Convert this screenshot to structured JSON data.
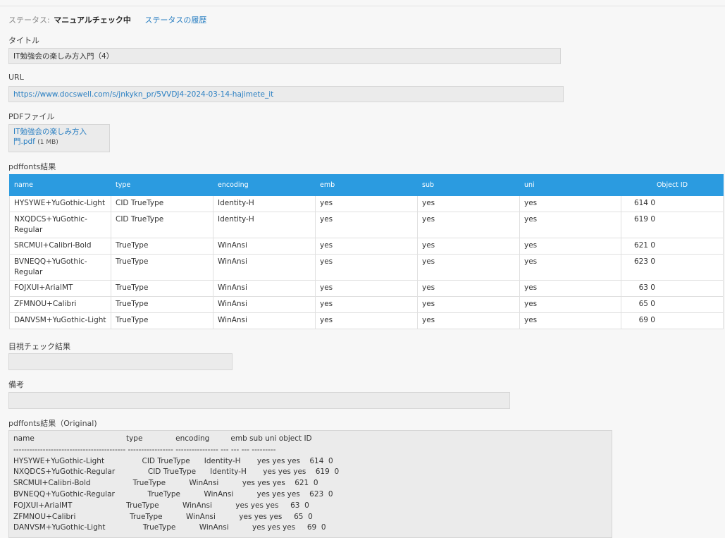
{
  "status": {
    "label": "ステータス:",
    "value": "マニュアルチェック中",
    "history_link": "ステータスの履歴"
  },
  "title": {
    "label": "タイトル",
    "value": "IT勉強会の楽しみ方入門（4）"
  },
  "url": {
    "label": "URL",
    "value": "https://www.docswell.com/s/jnkykn_pr/5VVDJ4-2024-03-14-hajimete_it"
  },
  "pdf": {
    "label": "PDFファイル",
    "link_line1": "IT勉強会の楽しみ方入",
    "link_line2": "門.pdf",
    "size": "(1 MB)"
  },
  "pdffonts": {
    "label": "pdffonts結果",
    "columns": [
      "name",
      "type",
      "encoding",
      "emb",
      "sub",
      "uni",
      "Object ID"
    ],
    "rows": [
      [
        "HYSYWE+YuGothic-Light",
        "CID TrueType",
        "Identity-H",
        "yes",
        "yes",
        "yes",
        "614  0"
      ],
      [
        "NXQDCS+YuGothic-Regular",
        "CID TrueType",
        "Identity-H",
        "yes",
        "yes",
        "yes",
        "619  0"
      ],
      [
        "SRCMUI+Calibri-Bold",
        "TrueType",
        "WinAnsi",
        "yes",
        "yes",
        "yes",
        "621  0"
      ],
      [
        "BVNEQQ+YuGothic-Regular",
        "TrueType",
        "WinAnsi",
        "yes",
        "yes",
        "yes",
        "623  0"
      ],
      [
        "FOJXUI+ArialMT",
        "TrueType",
        "WinAnsi",
        "yes",
        "yes",
        "yes",
        "63  0"
      ],
      [
        "ZFMNOU+Calibri",
        "TrueType",
        "WinAnsi",
        "yes",
        "yes",
        "yes",
        "65  0"
      ],
      [
        "DANVSM+YuGothic-Light",
        "TrueType",
        "WinAnsi",
        "yes",
        "yes",
        "yes",
        "69  0"
      ]
    ]
  },
  "visual_check": {
    "label": "目視チェック結果",
    "value": ""
  },
  "notes": {
    "label": "備考",
    "value": ""
  },
  "original": {
    "label": "pdffonts結果（Original)",
    "lines": [
      "name                                       type              encoding         emb sub uni object ID",
      "------------------------------------------ ----------------- ---------------- --- --- --- ---------",
      "HYSYWE+YuGothic-Light                CID TrueType      Identity-H       yes yes yes    614  0",
      "NXQDCS+YuGothic-Regular              CID TrueType      Identity-H       yes yes yes    619  0",
      "SRCMUI+Calibri-Bold                  TrueType          WinAnsi          yes yes yes    621  0",
      "BVNEQQ+YuGothic-Regular              TrueType          WinAnsi          yes yes yes    623  0",
      "FOJXUI+ArialMT                       TrueType          WinAnsi          yes yes yes     63  0",
      "ZFMNOU+Calibri                       TrueType          WinAnsi          yes yes yes     65  0",
      "DANVSM+YuGothic-Light                TrueType          WinAnsi          yes yes yes     69  0"
    ]
  },
  "colors": {
    "accent": "#2b9be0",
    "link": "#2a7fc2",
    "field_bg": "#ebebeb"
  }
}
